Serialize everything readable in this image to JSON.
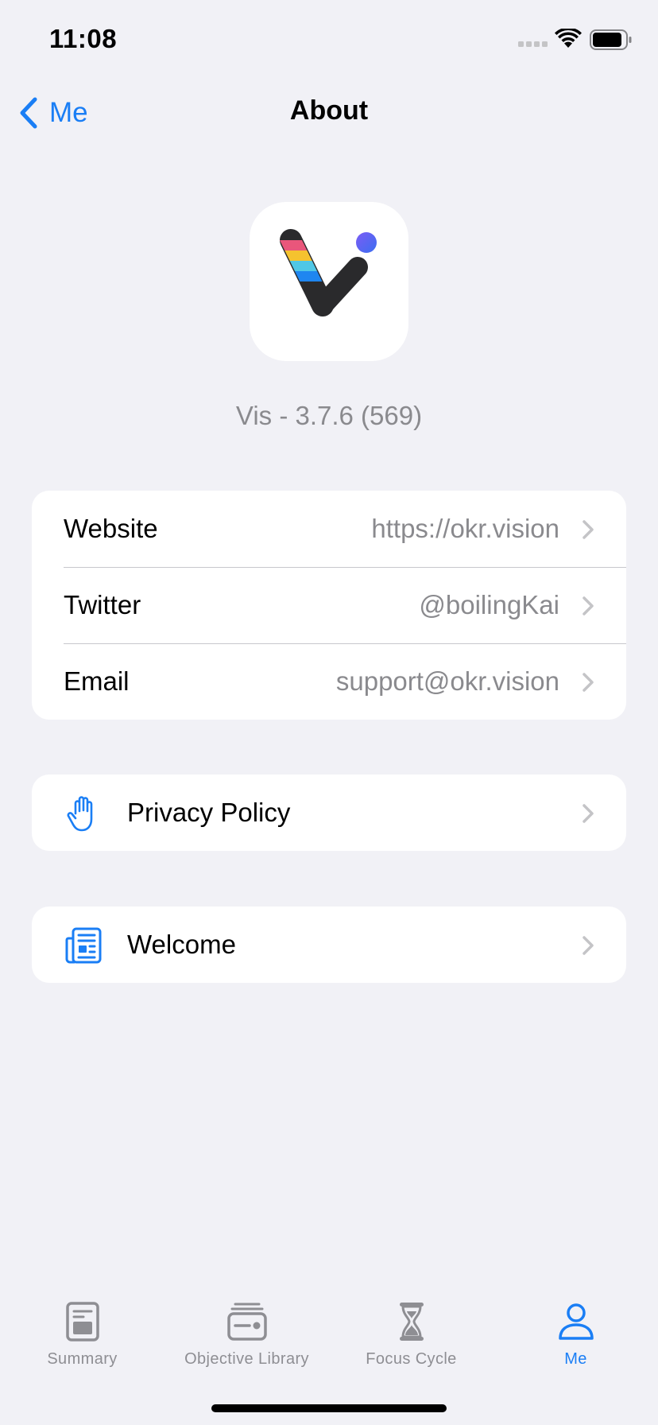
{
  "status": {
    "time": "11:08"
  },
  "nav": {
    "back_label": "Me",
    "title": "About"
  },
  "app": {
    "version": "Vis - 3.7.6 (569)"
  },
  "links": [
    {
      "label": "Website",
      "value": "https://okr.vision"
    },
    {
      "label": "Twitter",
      "value": "@boilingKai"
    },
    {
      "label": "Email",
      "value": "support@okr.vision"
    }
  ],
  "privacy": {
    "label": "Privacy Policy",
    "icon": "hand-raised-icon"
  },
  "welcome": {
    "label": "Welcome",
    "icon": "newspaper-icon"
  },
  "tabs": [
    {
      "label": "Summary",
      "icon": "summary-icon"
    },
    {
      "label": "Objective Library",
      "icon": "library-icon"
    },
    {
      "label": "Focus Cycle",
      "icon": "hourglass-icon"
    },
    {
      "label": "Me",
      "icon": "person-icon",
      "active": true
    }
  ],
  "colors": {
    "accent": "#1a7ef5",
    "background": "#f1f1f6",
    "secondary_text": "#8a8a8e"
  }
}
